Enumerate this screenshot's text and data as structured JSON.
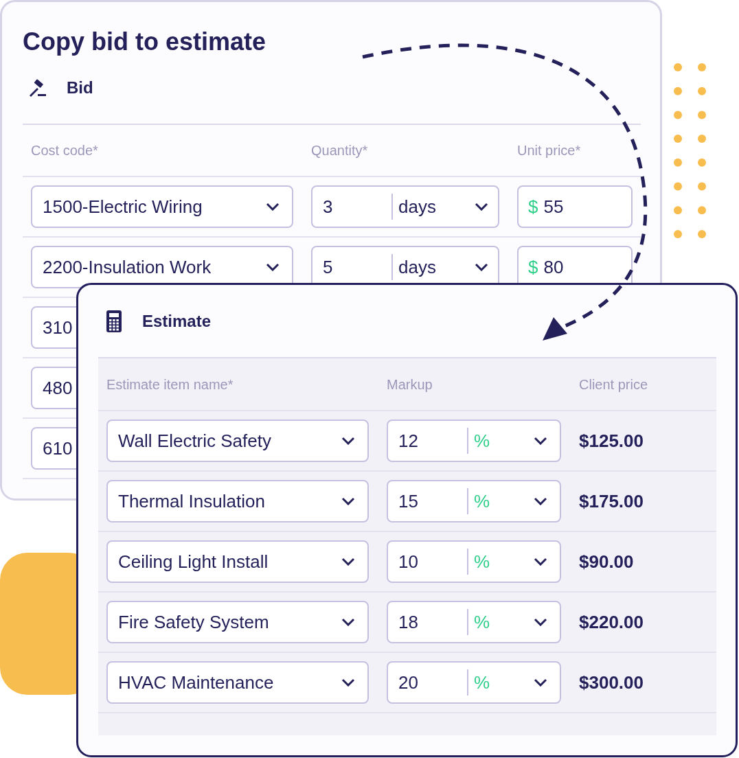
{
  "title": "Copy bid to estimate",
  "bid": {
    "heading": "Bid",
    "columns": [
      "Cost code*",
      "Quantity*",
      "Unit price*"
    ],
    "rows": [
      {
        "cost_code": "1500-Electric Wiring",
        "quantity": "3",
        "unit": "days",
        "currency": "$",
        "unit_price": "55"
      },
      {
        "cost_code": "2200-Insulation Work",
        "quantity": "5",
        "unit": "days",
        "currency": "$",
        "unit_price": "80"
      },
      {
        "cost_code": "310"
      },
      {
        "cost_code": "480"
      },
      {
        "cost_code": "610"
      }
    ]
  },
  "estimate": {
    "heading": "Estimate",
    "columns": [
      "Estimate item name*",
      "Markup",
      "Client price"
    ],
    "rows": [
      {
        "item_name": "Wall Electric Safety",
        "markup": "12",
        "markup_unit": "%",
        "client_price": "$125.00"
      },
      {
        "item_name": "Thermal Insulation",
        "markup": "15",
        "markup_unit": "%",
        "client_price": "$175.00"
      },
      {
        "item_name": "Ceiling Light Install",
        "markup": "10",
        "markup_unit": "%",
        "client_price": "$90.00"
      },
      {
        "item_name": "Fire Safety System",
        "markup": "18",
        "markup_unit": "%",
        "client_price": "$220.00"
      },
      {
        "item_name": "HVAC Maintenance",
        "markup": "20",
        "markup_unit": "%",
        "client_price": "$300.00"
      }
    ]
  }
}
